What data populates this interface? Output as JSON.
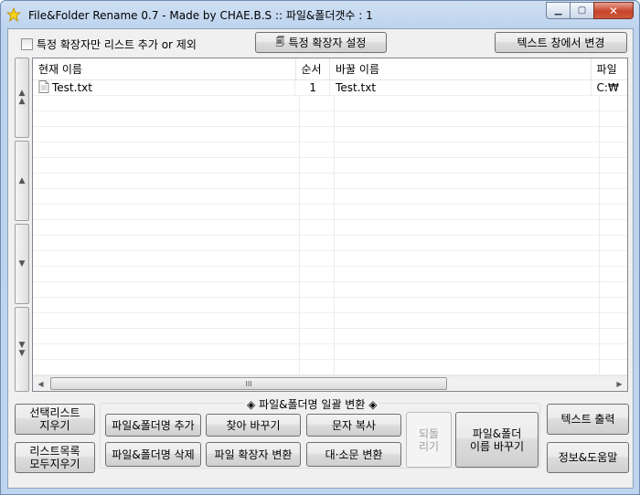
{
  "window": {
    "title": "File&Folder Rename 0.7 - Made by CHAE.B.S :: 파일&폴더갯수 : 1",
    "min_icon": "minimize-icon",
    "max_icon": "maximize-icon",
    "close_icon": "close-icon"
  },
  "top": {
    "filter_checkbox_label": "특정 확장자만 리스트 추가 or 제외",
    "filter_checked": false,
    "ext_settings_label": "특정 확장자 설정",
    "text_edit_label": "텍스트 창에서 변경"
  },
  "side_buttons": [
    {
      "icon": "move-to-top-icon"
    },
    {
      "icon": "move-up-icon"
    },
    {
      "icon": "move-down-icon"
    },
    {
      "icon": "move-to-bottom-icon"
    }
  ],
  "list": {
    "columns": [
      "현재 이름",
      "순서",
      "바꿀 이름",
      "파일"
    ],
    "rows": [
      {
        "current": "Test.txt",
        "order": "1",
        "new": "Test.txt",
        "path": "C:₩"
      }
    ],
    "scroll_grip": "III"
  },
  "bottom": {
    "clear_selected": "선택리스트\n지우기",
    "clear_all": "리스트목록\n모두지우기",
    "group_title": "◈ 파일&폴더명 일괄 변환 ◈",
    "add": "파일&폴더명 추가",
    "find_replace": "찾아 바꾸기",
    "copy_text": "문자 복사",
    "delete": "파일&폴더명 삭제",
    "ext_change": "파일 확장자 변환",
    "case_change": "대·소문 변환",
    "undo": "되돌\n리기",
    "rename": "파일&폴더\n이름 바꾸기",
    "text_output": "텍스트 출력",
    "info_help": "정보&도움말"
  },
  "colors": {
    "titlebar": "#bfd5ef",
    "client_bg": "#f0f0f0",
    "close_button": "#c7442a"
  }
}
